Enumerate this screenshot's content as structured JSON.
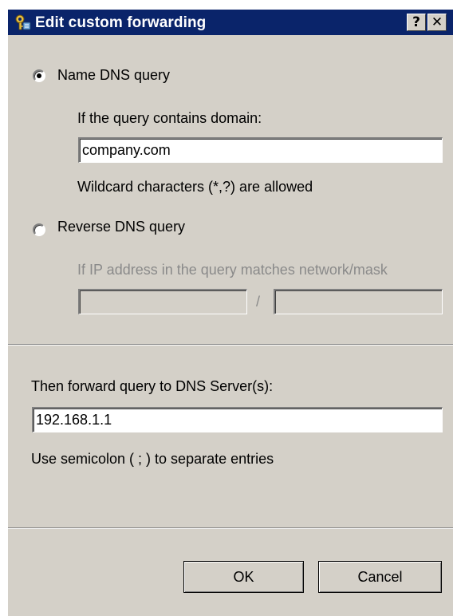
{
  "window": {
    "title": "Edit custom forwarding",
    "help_label": "?",
    "close_label": "✕",
    "icon": "network-key-icon"
  },
  "name_query": {
    "label": "Name DNS query",
    "selected": true,
    "domain_prompt": "If the query contains domain:",
    "domain_value": "company.com",
    "wildcard_hint": "Wildcard characters (*,?) are allowed"
  },
  "reverse_query": {
    "label": "Reverse DNS query",
    "selected": false,
    "prompt": "If IP address in the query matches network/mask",
    "network_value": "",
    "separator": "/",
    "mask_value": ""
  },
  "forward": {
    "prompt": "Then forward query to DNS Server(s):",
    "servers_value": "192.168.1.1",
    "hint": "Use semicolon ( ; ) to separate entries"
  },
  "buttons": {
    "ok_label": "OK",
    "cancel_label": "Cancel"
  },
  "colors": {
    "titlebar": "#0a246a",
    "dialog_face": "#d4d0c8",
    "disabled_text": "#8a8a8a"
  }
}
